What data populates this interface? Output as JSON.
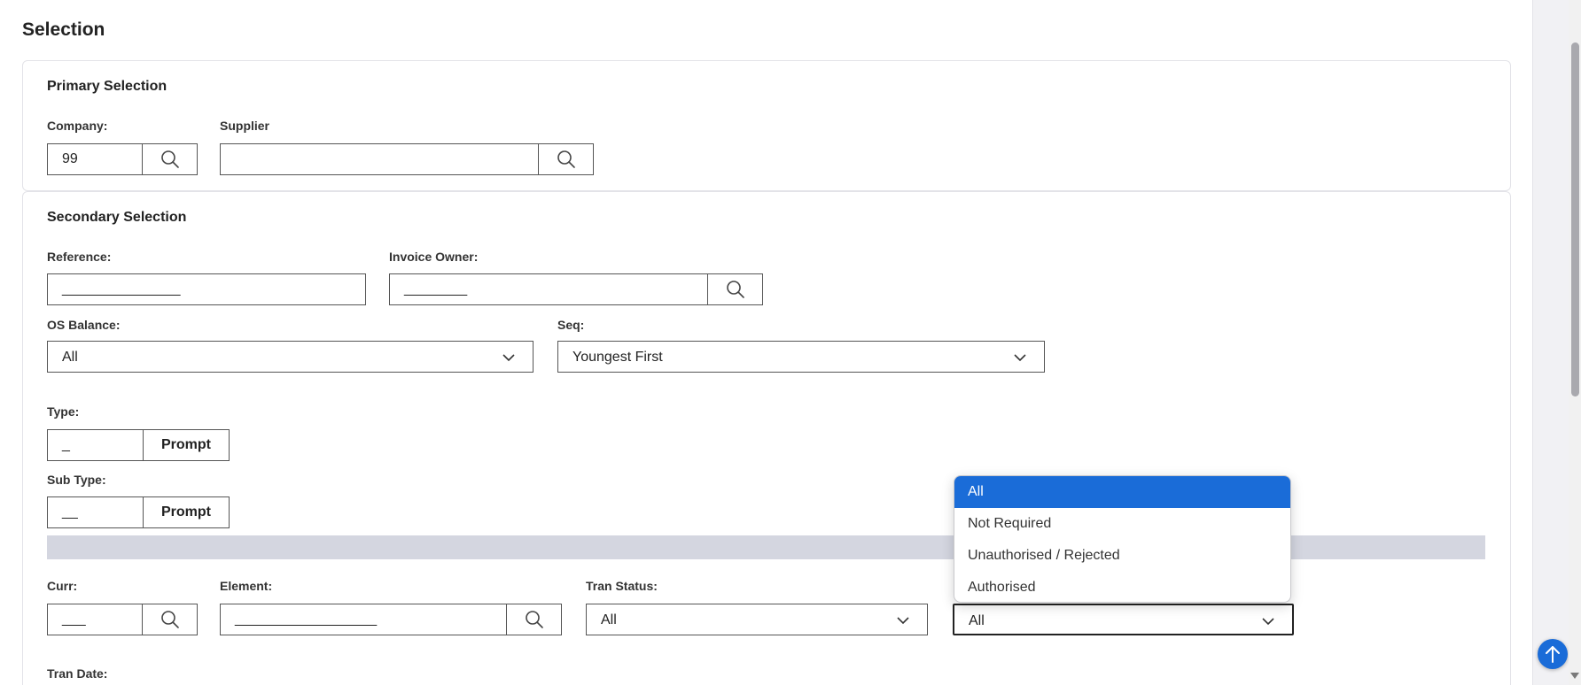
{
  "page": {
    "title": "Selection"
  },
  "primary": {
    "title": "Primary Selection",
    "company": {
      "label": "Company:",
      "value": "99"
    },
    "supplier": {
      "label": "Supplier",
      "value": ""
    }
  },
  "secondary": {
    "title": "Secondary Selection",
    "reference": {
      "label": "Reference:",
      "value": "_______________"
    },
    "invoice_owner": {
      "label": "Invoice Owner:",
      "value": "________"
    },
    "os_balance": {
      "label": "OS Balance:",
      "value": "All"
    },
    "seq": {
      "label": "Seq:",
      "value": "Youngest First"
    },
    "type": {
      "label": "Type:",
      "value": "_",
      "button": "Prompt"
    },
    "sub_type": {
      "label": "Sub Type:",
      "value": "__",
      "button": "Prompt"
    },
    "curr": {
      "label": "Curr:",
      "value": "___"
    },
    "element": {
      "label": "Element:",
      "value": "__________________"
    },
    "tran_status": {
      "label": "Tran Status:",
      "value": "All"
    },
    "auth_status": {
      "value": "All"
    },
    "tran_date": {
      "label": "Tran Date:"
    }
  },
  "dropdown": {
    "options": [
      "All",
      "Not Required",
      "Unauthorised / Rejected",
      "Authorised"
    ],
    "selected_index": 0
  },
  "colors": {
    "accent": "#1a6cd8",
    "bar": "#d4d6e0"
  },
  "icons": {
    "search": "magnifier-icon",
    "chevron": "chevron-down-icon",
    "scroll_top": "arrow-up-icon"
  }
}
